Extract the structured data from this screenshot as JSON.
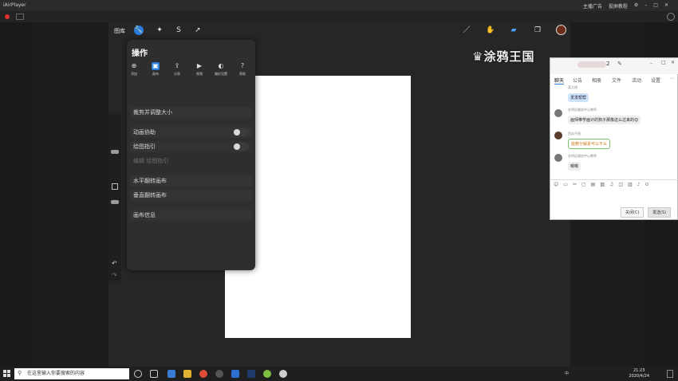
{
  "player": {
    "title": "iAirPlayer",
    "right_items": [
      "主播广告",
      "投屏教程",
      "⚙",
      "–",
      "□",
      "✕"
    ]
  },
  "procreate": {
    "gallery_label": "图库",
    "actions_panel": {
      "title": "操作",
      "tabs": [
        "添加",
        "画布",
        "分享",
        "视频",
        "偏好设置",
        "帮助"
      ],
      "active_tab": 1,
      "rows": {
        "crop_resize": "裁剪并调整大小",
        "animation_assist": "动画协助",
        "drawing_guide": "绘图指引",
        "edit_drawing_guide": "编辑 绘图指引",
        "flip_horizontal": "水平翻转画布",
        "flip_vertical": "垂直翻转画布",
        "canvas_info": "画布信息"
      }
    }
  },
  "watermark": "涂鸦王国",
  "chat": {
    "tabs": [
      "聊天",
      "公告",
      "相册",
      "文件",
      "活动",
      "设置"
    ],
    "active_tab": 0,
    "head_num": "2",
    "messages": [
      {
        "name": "菜大佬",
        "text": "发发帮帮",
        "style": "blue"
      },
      {
        "name": "金明远服务中心教师",
        "text": "画师带学画计的狗子那像这么过来的😊",
        "style": "gray"
      },
      {
        "name": "西瓜不甜",
        "text": "能教分解素可以不么",
        "style": "green"
      },
      {
        "name": "金明远服务中心教师",
        "text": "嗯嗯",
        "style": "gray"
      }
    ],
    "close_label": "关闭(C)",
    "send_label": "发送(S)"
  },
  "taskbar": {
    "search_placeholder": "在这里输入你要搜索的内容",
    "time": "21:23",
    "date": "2020/4/24",
    "lang": "中"
  },
  "colors": {
    "accent": "#2b7cdc",
    "color_swatch": "#6b2c1a"
  }
}
